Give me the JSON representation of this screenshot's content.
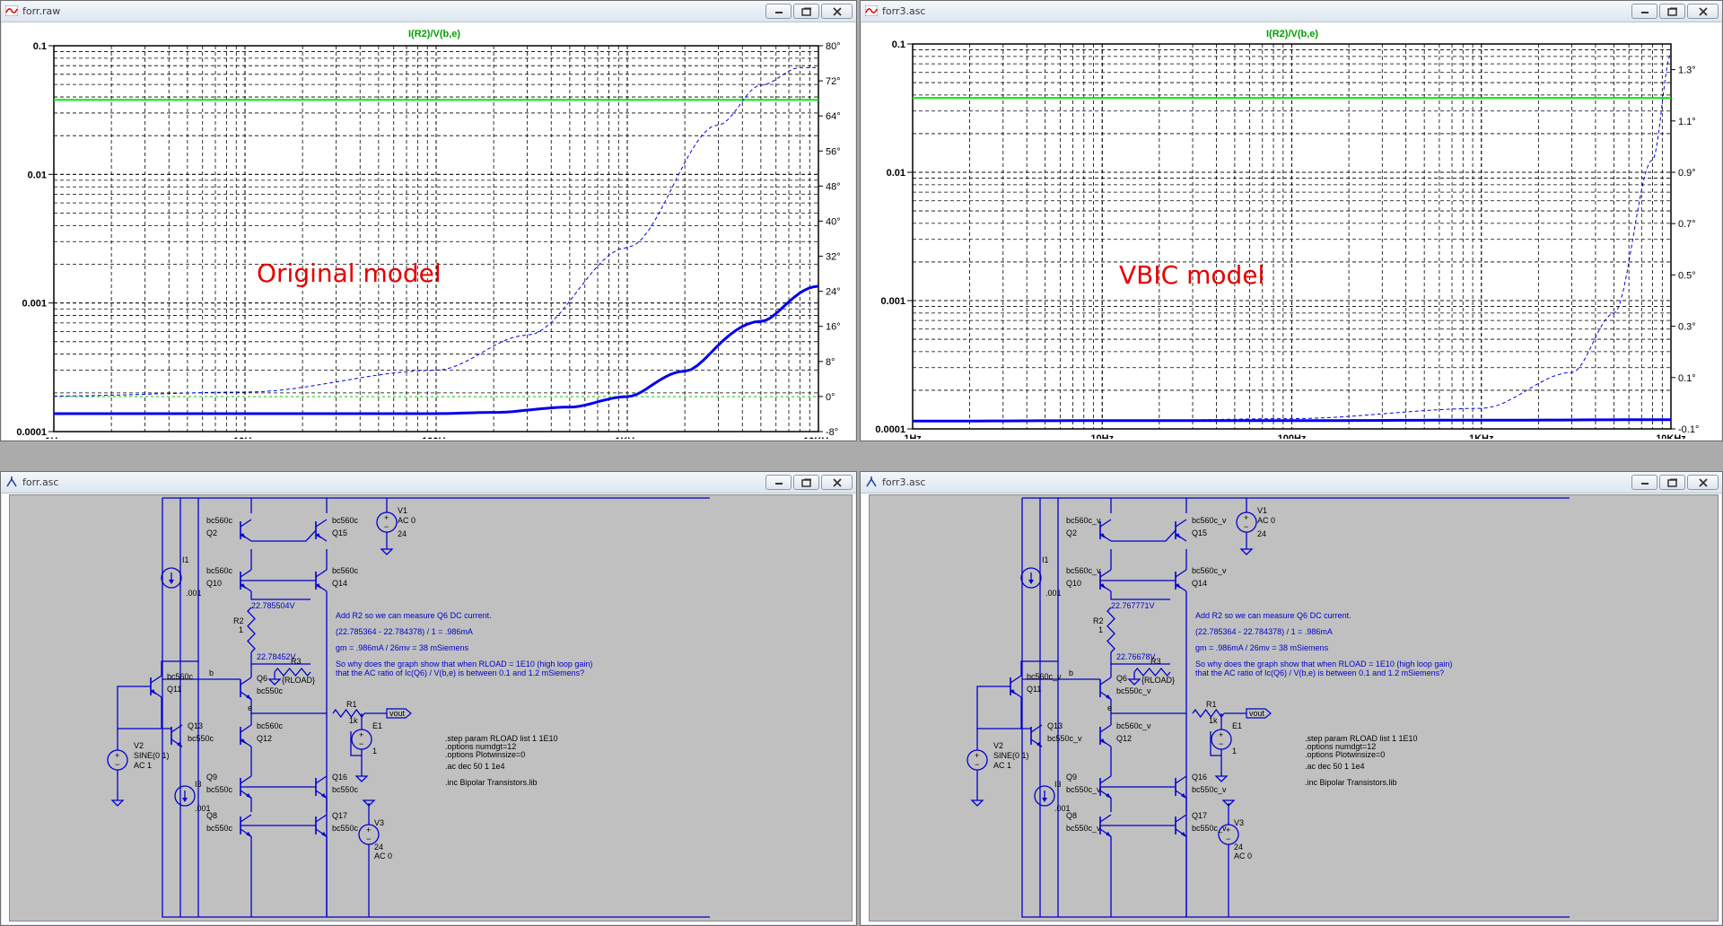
{
  "windows": {
    "plot_left": {
      "title": "forr.raw",
      "trace_title": "I(R2)/V(b,e)",
      "annotation": "Original model"
    },
    "plot_right": {
      "title": "forr3.asc",
      "trace_title": "I(R2)/V(b,e)",
      "annotation": "VBIC model"
    },
    "schem_left": {
      "title": "forr.asc"
    },
    "schem_right": {
      "title": "forr3.asc"
    }
  },
  "plot_left_axes": {
    "y_left": [
      "0.1",
      "0.01",
      "0.001",
      "0.0001"
    ],
    "y_right": [
      "80°",
      "72°",
      "64°",
      "56°",
      "48°",
      "40°",
      "32°",
      "24°",
      "16°",
      "8°",
      "0°",
      "-8°"
    ],
    "x": [
      "1Hz",
      "10Hz",
      "100Hz",
      "1KHz",
      "10KHz"
    ]
  },
  "plot_right_axes": {
    "y_left": [
      "0.1",
      "0.01",
      "0.001",
      "0.0001"
    ],
    "y_right": [
      "1.3°",
      "1.1°",
      "0.9°",
      "0.7°",
      "0.5°",
      "0.3°",
      "0.1°",
      "-0.1°"
    ],
    "x": [
      "1Hz",
      "10Hz",
      "100Hz",
      "1KHz",
      "10KHz"
    ]
  },
  "chart_data": [
    {
      "type": "line",
      "title": "I(R2)/V(b,e)",
      "x_scale": "log",
      "xlim": [
        1,
        10000
      ],
      "y_scale": "log",
      "ylim": [
        0.0001,
        0.1
      ],
      "y2lim": [
        -8,
        80
      ],
      "grid": true,
      "series": [
        {
          "style": "green solid (magnitude)",
          "x": [
            1,
            10,
            100,
            1000,
            10000
          ],
          "y": [
            0.038,
            0.038,
            0.038,
            0.038,
            0.038
          ]
        },
        {
          "style": "blue thick solid",
          "x": [
            1,
            10,
            100,
            200,
            500,
            1000,
            2000,
            5000,
            10000
          ],
          "y": [
            0.000138,
            0.000138,
            0.000138,
            0.000141,
            0.000155,
            0.000187,
            0.000295,
            0.00072,
            0.00135
          ]
        },
        {
          "style": "blue dashed (phase, right axis)",
          "x": [
            1,
            10,
            100,
            300,
            1000,
            3000,
            5000,
            8000,
            10000
          ],
          "y": [
            0.1,
            1,
            6,
            14,
            34,
            62,
            71,
            75,
            75
          ]
        }
      ],
      "annotations": [
        "Original model"
      ]
    },
    {
      "type": "line",
      "title": "I(R2)/V(b,e)",
      "x_scale": "log",
      "xlim": [
        1,
        10000
      ],
      "y_scale": "log",
      "ylim": [
        0.0001,
        0.1
      ],
      "y2lim": [
        -0.1,
        1.4
      ],
      "grid": true,
      "series": [
        {
          "style": "green solid (magnitude)",
          "x": [
            1,
            10,
            100,
            1000,
            10000
          ],
          "y": [
            0.038,
            0.038,
            0.038,
            0.038,
            0.038
          ]
        },
        {
          "style": "blue thick solid",
          "x": [
            1,
            10,
            100,
            1000,
            10000
          ],
          "y": [
            0.000115,
            0.000116,
            0.000116,
            0.000117,
            0.000118
          ]
        },
        {
          "style": "blue dashed (phase, right axis)",
          "x": [
            1,
            10,
            100,
            1000,
            3000,
            5000,
            8000,
            10000
          ],
          "y": [
            -0.07,
            -0.07,
            -0.06,
            -0.02,
            0.12,
            0.35,
            0.95,
            1.36
          ]
        }
      ],
      "annotations": [
        "VBIC model"
      ]
    }
  ],
  "schem_left": {
    "transistors": {
      "q2": [
        "bc560c",
        "Q2"
      ],
      "q15": [
        "bc560c",
        "Q15"
      ],
      "q10": [
        "bc560c",
        "Q10"
      ],
      "q14": [
        "bc560c",
        "Q14"
      ],
      "q6": [
        "Q6",
        "bc550c"
      ],
      "q11": [
        "bc560c",
        "Q11"
      ],
      "q13": [
        "Q13",
        "bc550c"
      ],
      "q12": [
        "bc560c",
        "Q12"
      ],
      "q9": [
        "Q9",
        "bc550c"
      ],
      "q16": [
        "Q16",
        "bc550c"
      ],
      "q8": [
        "Q8",
        "bc550c"
      ],
      "q17": [
        "Q17",
        "bc550c"
      ]
    },
    "voltage_top": "22.785504V",
    "voltage_mid": "22.78452V"
  },
  "schem_right": {
    "transistors": {
      "q2": [
        "bc560c_v",
        "Q2"
      ],
      "q15": [
        "bc560c_v",
        "Q15"
      ],
      "q10": [
        "bc560c_v",
        "Q10"
      ],
      "q14": [
        "bc560c_v",
        "Q14"
      ],
      "q6": [
        "Q6",
        "bc550c_v"
      ],
      "q11": [
        "bc560c_v",
        "Q11"
      ],
      "q13": [
        "Q13",
        "bc550c_v"
      ],
      "q12": [
        "bc560c_v",
        "Q12"
      ],
      "q9": [
        "Q9",
        "bc550c_v"
      ],
      "q16": [
        "Q16",
        "bc550c_v"
      ],
      "q8": [
        "Q8",
        "bc550c_v"
      ],
      "q17": [
        "Q17",
        "bc550c_v"
      ]
    },
    "voltage_top": "22.767771V",
    "voltage_mid": "22.76678V"
  },
  "schem_common": {
    "v1": [
      "V1",
      "AC 0",
      "24"
    ],
    "i1": [
      "I1",
      ".001"
    ],
    "r2": [
      "R2",
      "1"
    ],
    "r3": [
      "R3",
      "{RLOAD}"
    ],
    "r1": [
      "R1",
      "1k"
    ],
    "e1": [
      "E1",
      "1"
    ],
    "v2": [
      "V2",
      "SINE(0 1)",
      "AC 1"
    ],
    "i3": [
      "I3",
      ".001"
    ],
    "v3": [
      "V3",
      "24",
      "AC 0"
    ],
    "node_b": "b",
    "node_e": "e",
    "vout": "vout",
    "comments": [
      "Add R2 so we can measure Q6 DC current.",
      "(22.785364 - 22.784378) / 1 = .986mA",
      "gm = .986mA / 26mv = 38 mSiemens",
      "So why does the graph show that when RLOAD = 1E10 (high loop gain)",
      "that the AC ratio of Ic(Q6) / V(b,e) is between 0.1 and 1.2 mSiemens?"
    ],
    "directives": [
      ".step param RLOAD list 1 1E10",
      ".options numdgt=12",
      ".options Plotwinsize=0",
      ".ac dec 50 1 1e4",
      ".inc Bipolar Transistors.lib"
    ]
  }
}
